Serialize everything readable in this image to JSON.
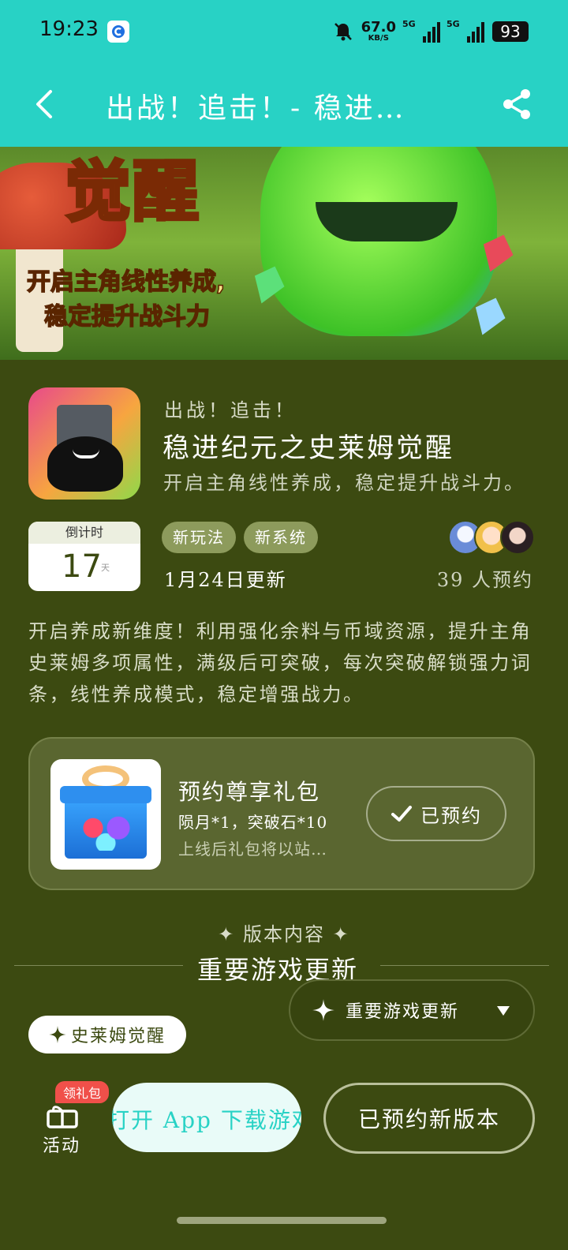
{
  "status_bar": {
    "time": "19:23",
    "net_speed_value": "67.0",
    "net_speed_unit": "KB/S",
    "signal_1_label": "5G",
    "signal_2_label": "5G",
    "battery": "93",
    "icons": [
      "app-notification-icon",
      "mute-bell-icon",
      "signal-icon",
      "battery-icon"
    ]
  },
  "app_bar": {
    "title": "出战！追击！- 稳进…",
    "icons": [
      "back-arrow-icon",
      "share-icon"
    ],
    "background_color": "#28d2c5"
  },
  "banner": {
    "headline": "觉醒",
    "slogan_line_1": "开启主角线性养成,",
    "slogan_line_2": "稳定提升战斗力"
  },
  "game": {
    "subtitle": "出战！追击！",
    "name": "稳进纪元之史莱姆觉醒",
    "tagline": "开启主角线性养成，稳定提升战斗力。",
    "countdown_label": "倒计时",
    "countdown_value": "17",
    "countdown_unit": "天",
    "tags": [
      "新玩法",
      "新系统"
    ],
    "update_date": "1月24日更新",
    "reserve_count": "39 人预约",
    "description": "开启养成新维度！利用强化余料与币域资源，提升主角史莱姆多项属性，满级后可突破，每次突破解锁强力词条，线性养成模式，稳定增强战力。"
  },
  "gift": {
    "title": "预约尊享礼包",
    "items": "陨月*1，突破石*10",
    "note": "上线后礼包将以站…",
    "button_label": "已预约",
    "button_icon": "checkmark-icon"
  },
  "version": {
    "label": "✦ 版本内容 ✦",
    "section_title": "重要游戏更新",
    "dropdown_value": "重要游戏更新",
    "dropdown_icon": "sparkle-icon",
    "chip_label": "史莱姆觉醒"
  },
  "bottom_bar": {
    "activity_label": "活动",
    "activity_badge": "领礼包",
    "open_app_label": "打开 App 下载游戏",
    "reserved_version_label": "已预约新版本"
  },
  "colors": {
    "page_background": "#3c4a11",
    "accent": "#28d2c5",
    "tag_background": "#8d9b5c",
    "badge_red": "#f0504a"
  }
}
